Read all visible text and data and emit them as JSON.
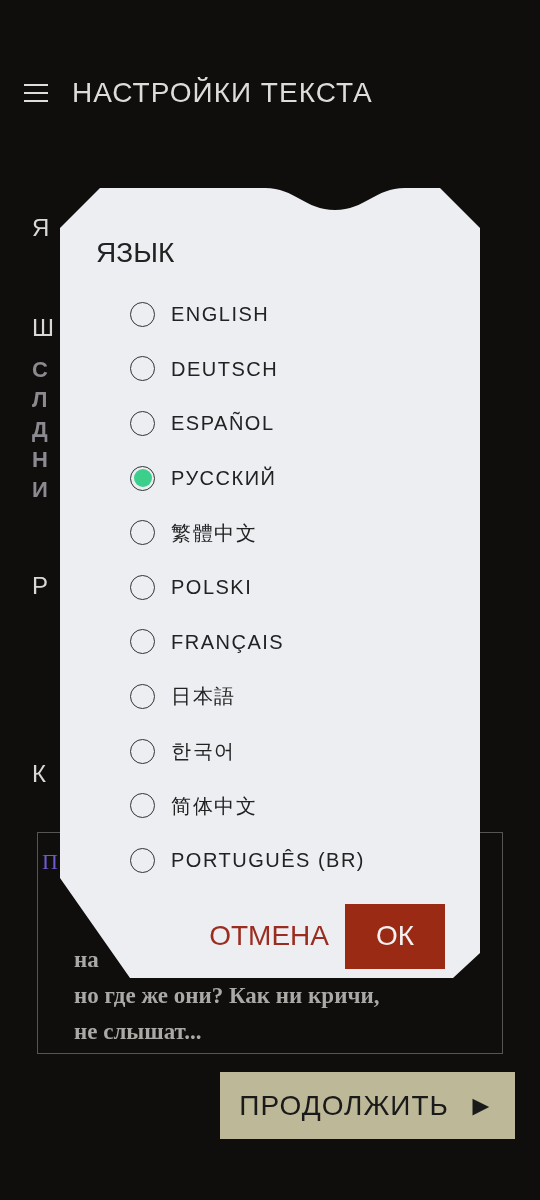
{
  "header": {
    "title": "НАСТРОЙКИ ТЕКСТА"
  },
  "background_letters": [
    {
      "text": "Я",
      "kind": "heading"
    },
    {
      "text": "Ш",
      "kind": "heading"
    },
    {
      "text": "С",
      "kind": "body"
    },
    {
      "text": "Л",
      "kind": "body"
    },
    {
      "text": "Д",
      "kind": "body"
    },
    {
      "text": "Н",
      "kind": "body"
    },
    {
      "text": "И",
      "kind": "body"
    },
    {
      "text": "Р",
      "kind": "heading"
    },
    {
      "text": "К",
      "kind": "heading"
    }
  ],
  "text_card": {
    "heading_fragment": "П",
    "lines": [
      "на",
      "но где же они? Как ни кричи,",
      "не слышат..."
    ]
  },
  "continue_button": {
    "label": "ПРОДОЛЖИТЬ",
    "arrow": "►"
  },
  "dialog": {
    "title": "ЯЗЫК",
    "options": [
      {
        "label": "ENGLISH",
        "selected": false
      },
      {
        "label": "DEUTSCH",
        "selected": false
      },
      {
        "label": "ESPAÑOL",
        "selected": false
      },
      {
        "label": "РУССКИЙ",
        "selected": true
      },
      {
        "label": "繁體中文",
        "selected": false
      },
      {
        "label": "POLSKI",
        "selected": false
      },
      {
        "label": "FRANÇAIS",
        "selected": false
      },
      {
        "label": "日本語",
        "selected": false
      },
      {
        "label": "한국어",
        "selected": false
      },
      {
        "label": "简体中文",
        "selected": false
      },
      {
        "label": "PORTUGUÊS (BR)",
        "selected": false
      }
    ],
    "cancel": "ОТМЕНА",
    "ok": "ОК"
  }
}
